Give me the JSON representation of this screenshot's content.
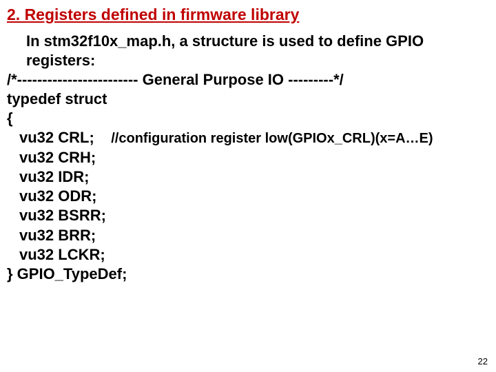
{
  "title": "2. Registers defined in firmware library",
  "intro_line1": "In stm32f10x_map.h, a structure is used to define GPIO",
  "intro_line2": "registers:",
  "code": {
    "banner": "/*------------------------ General Purpose IO ---------*/",
    "typedef": "typedef struct",
    "open_brace": "{",
    "crl_field": "vu32 CRL;",
    "crl_comment": "//configuration register low(GPIOx_CRL)(x=A…E)",
    "crh": "vu32 CRH;",
    "idr": "vu32 IDR;",
    "odr": "vu32 ODR;",
    "bsrr": "vu32 BSRR;",
    "brr": "vu32 BRR;",
    "lckr": "vu32 LCKR;",
    "close": "} GPIO_TypeDef;"
  },
  "page_number": "22"
}
